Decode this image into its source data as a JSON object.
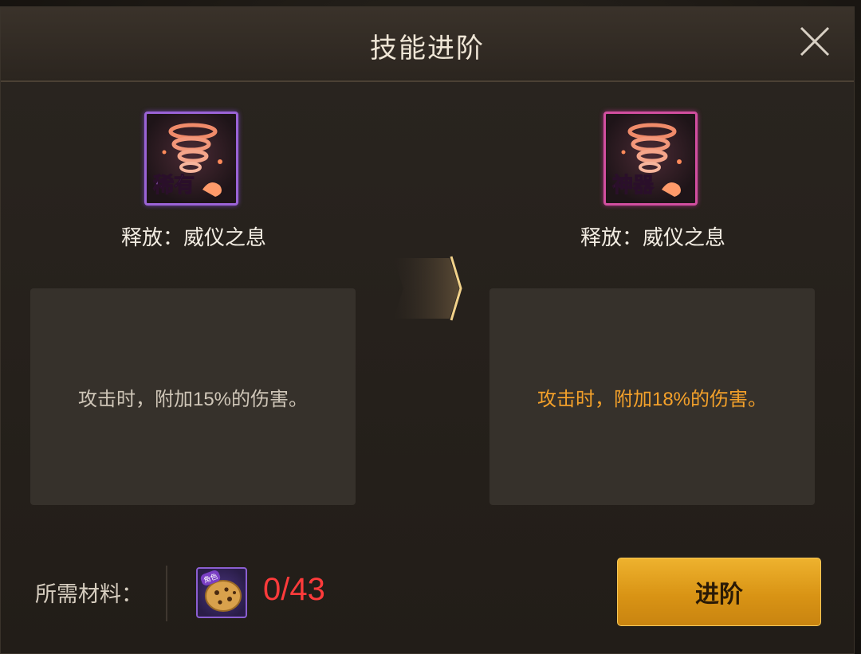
{
  "dialog": {
    "title": "技能进阶",
    "close_icon": "close-icon"
  },
  "current_skill": {
    "rarity": "稀有",
    "rarity_color": "#c07cff",
    "name": "释放：威仪之息",
    "description": "攻击时，附加15%的伤害。",
    "icon": "tornado-skill-icon"
  },
  "next_skill": {
    "rarity": "神器",
    "rarity_color": "#ff64c8",
    "name": "释放：威仪之息",
    "description": "攻击时，附加18%的伤害。",
    "description_color": "#f4a12a",
    "icon": "tornado-skill-icon"
  },
  "materials": {
    "label": "所需材料：",
    "item_badge": "角色",
    "item_icon": "cookie-icon",
    "count": "0/43",
    "count_color": "#ff3b3b"
  },
  "actions": {
    "advance_label": "进阶"
  }
}
